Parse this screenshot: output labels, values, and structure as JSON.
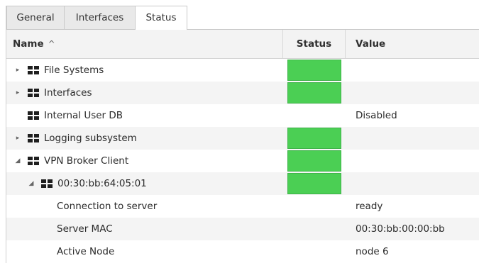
{
  "tabs": [
    {
      "label": "General"
    },
    {
      "label": "Interfaces"
    },
    {
      "label": "Status"
    }
  ],
  "table": {
    "columns": {
      "name": "Name",
      "sort_icon": "^",
      "status": "Status",
      "value": "Value"
    },
    "rows": [
      {
        "name": "File Systems",
        "value": "",
        "status": "green"
      },
      {
        "name": "Interfaces",
        "value": "",
        "status": "green"
      },
      {
        "name": "Internal User DB",
        "value": "Disabled",
        "status": ""
      },
      {
        "name": "Logging subsystem",
        "value": "",
        "status": "green"
      },
      {
        "name": "VPN Broker Client",
        "value": "",
        "status": "green"
      },
      {
        "name": "00:30:bb:64:05:01",
        "value": "",
        "status": "green"
      },
      {
        "name": "Connection to server",
        "value": "ready",
        "status": ""
      },
      {
        "name": "Server MAC",
        "value": "00:30:bb:00:00:bb",
        "status": ""
      },
      {
        "name": "Active Node",
        "value": "node 6",
        "status": ""
      }
    ]
  },
  "icons": {
    "collapsed": "▸",
    "expanded": "◢",
    "node": "grid-icon"
  },
  "colors": {
    "status_ok": "#4bcf54"
  }
}
